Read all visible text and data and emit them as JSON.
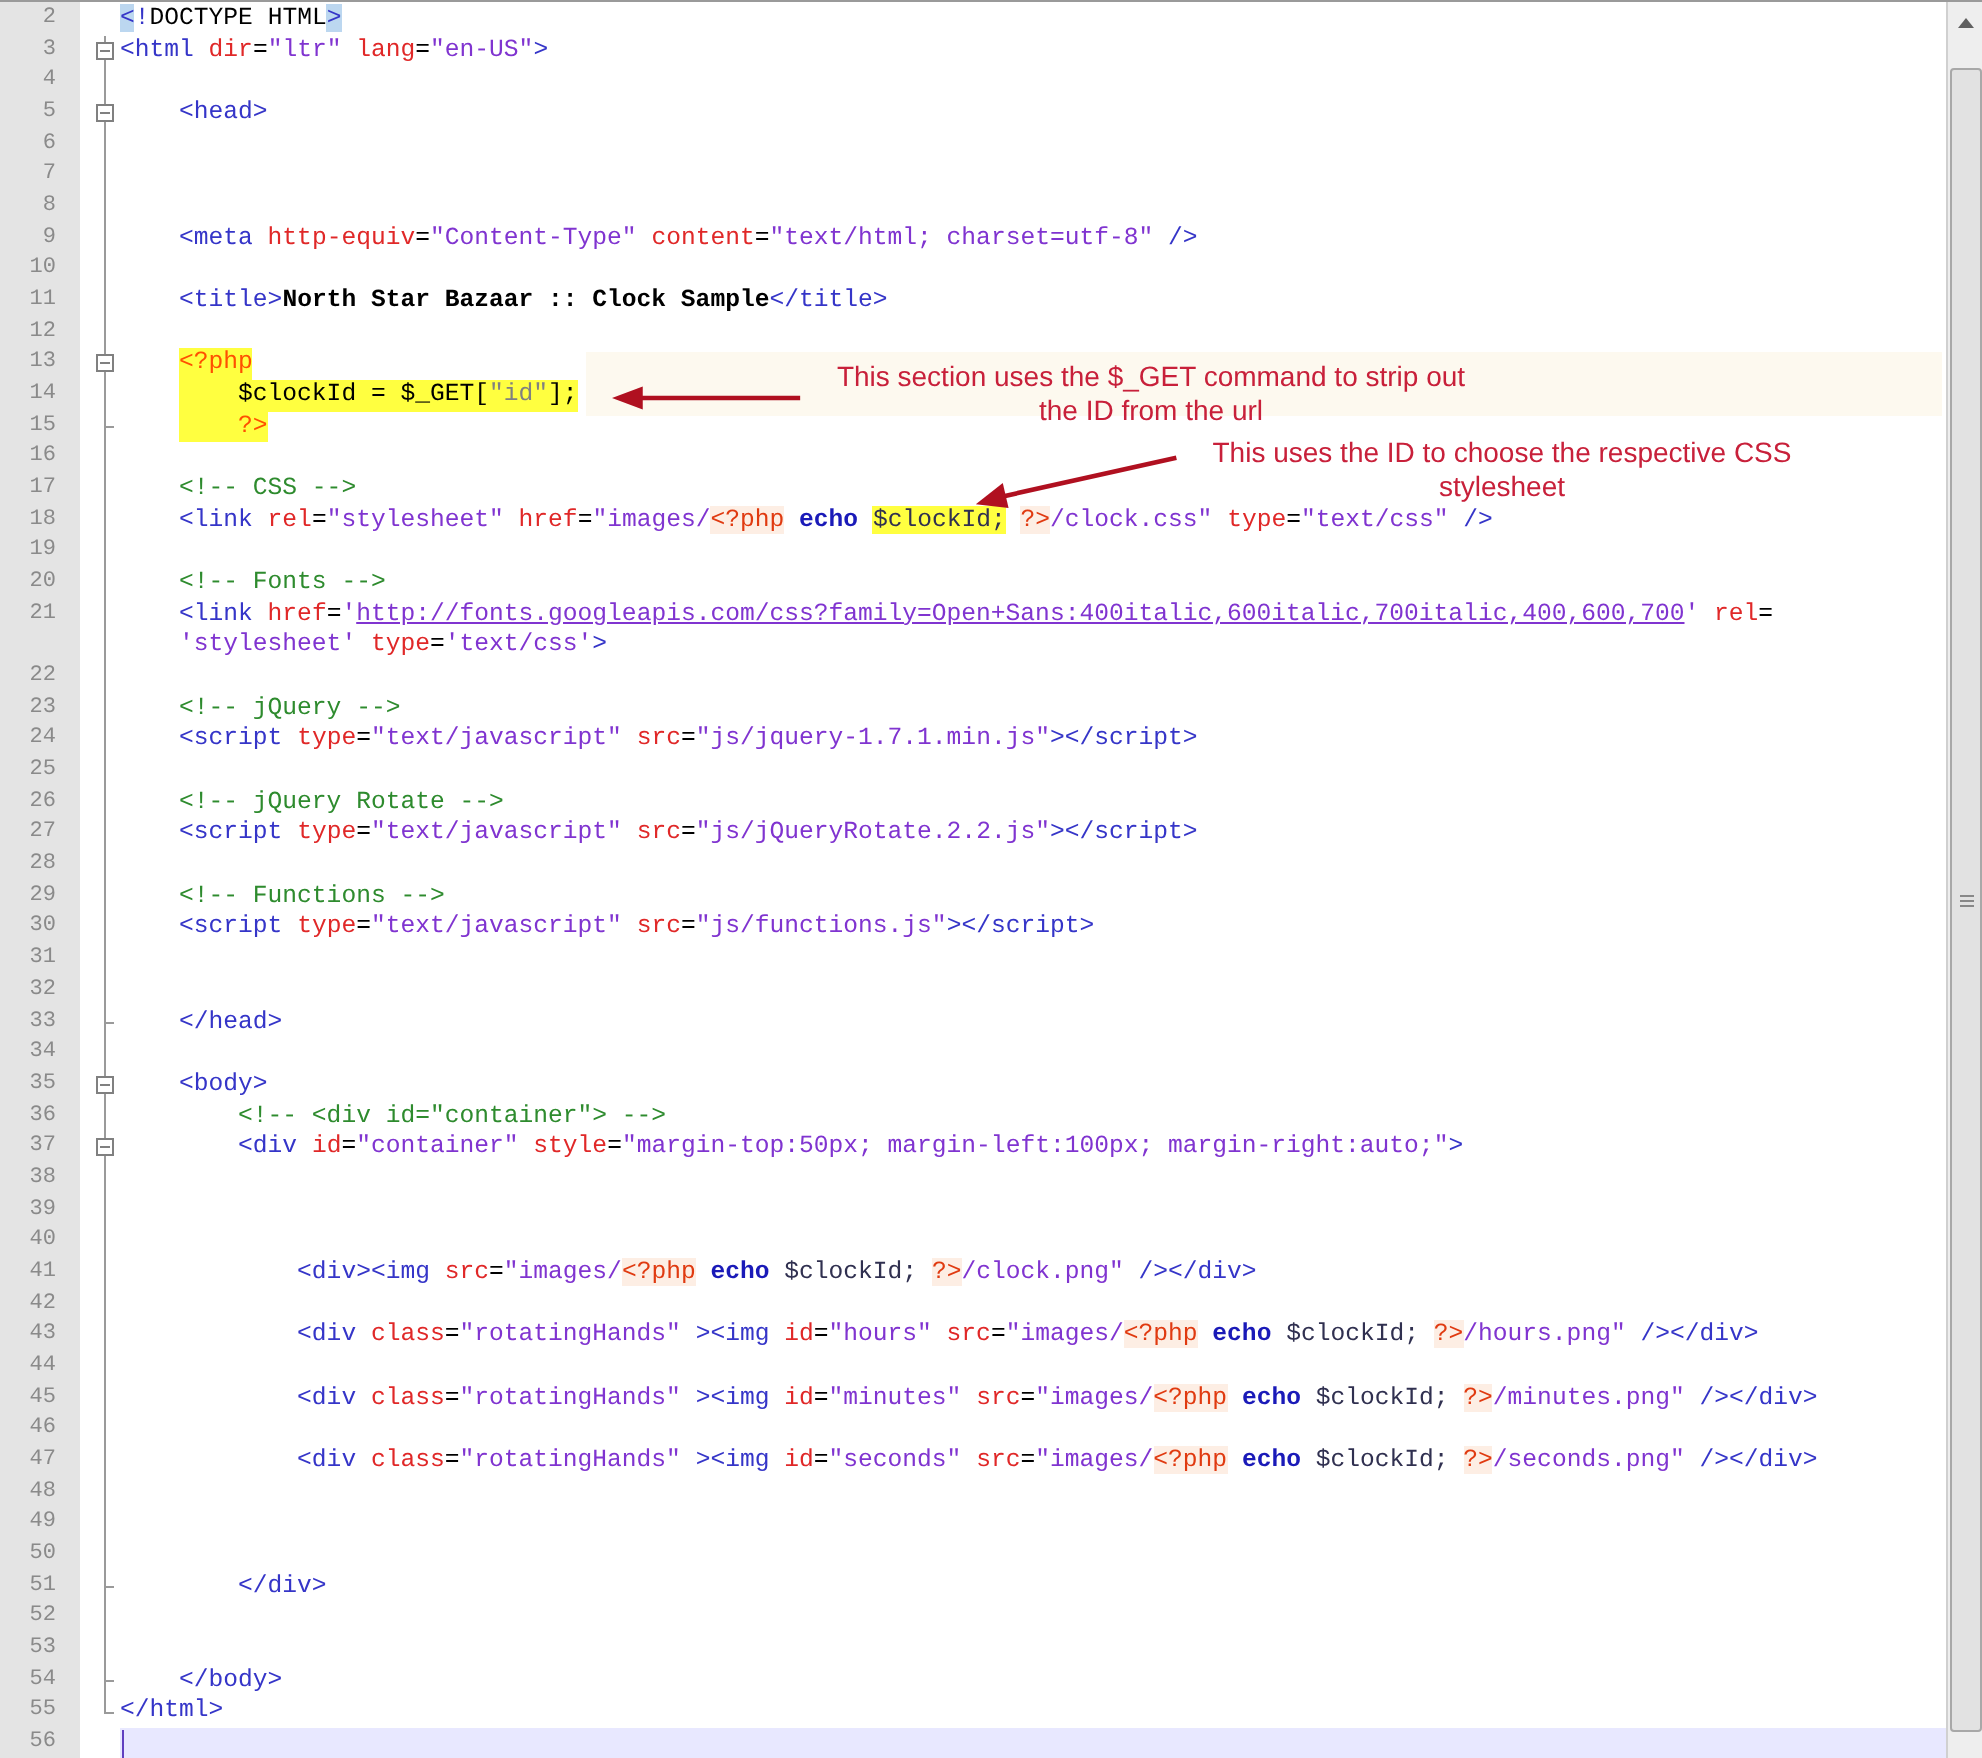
{
  "editor": {
    "lines": [
      {
        "number": "2",
        "tokens": [
          {
            "kind": "match",
            "text": "<"
          },
          {
            "kind": "tag",
            "text": "!"
          },
          {
            "kind": "plain",
            "text": "DOCTYPE HTML"
          },
          {
            "kind": "match",
            "text": ">"
          }
        ]
      },
      {
        "number": "3",
        "fold_start": true,
        "tokens": [
          {
            "kind": "tag",
            "text": "<html"
          },
          {
            "kind": "attr",
            "text": " dir"
          },
          {
            "kind": "plain",
            "text": "="
          },
          {
            "kind": "string",
            "text": "\"ltr\""
          },
          {
            "kind": "attr",
            "text": " lang"
          },
          {
            "kind": "plain",
            "text": "="
          },
          {
            "kind": "string",
            "text": "\"en-US\""
          },
          {
            "kind": "tag",
            "text": ">"
          }
        ]
      },
      {
        "number": "4"
      },
      {
        "number": "5",
        "fold_start": true,
        "tokens": [
          {
            "kind": "tag",
            "text": "    <head>"
          }
        ]
      },
      {
        "number": "6"
      },
      {
        "number": "7"
      },
      {
        "number": "8"
      },
      {
        "number": "9",
        "tokens": [
          {
            "kind": "tag",
            "text": "    <meta"
          },
          {
            "kind": "attr",
            "text": " http-equiv"
          },
          {
            "kind": "plain",
            "text": "="
          },
          {
            "kind": "string",
            "text": "\"Content-Type\""
          },
          {
            "kind": "attr",
            "text": " content"
          },
          {
            "kind": "plain",
            "text": "="
          },
          {
            "kind": "string",
            "text": "\"text/html; charset=utf-8\""
          },
          {
            "kind": "tag",
            "text": " />"
          }
        ]
      },
      {
        "number": "10"
      },
      {
        "number": "11",
        "tokens": [
          {
            "kind": "tag",
            "text": "    <title>"
          },
          {
            "kind": "text",
            "text": "North Star Bazaar :: Clock Sample"
          },
          {
            "kind": "tag",
            "text": "</title>"
          }
        ]
      },
      {
        "number": "12"
      },
      {
        "number": "13",
        "fold_start": true,
        "php_block": true,
        "tokens": [
          {
            "kind": "php-delim",
            "text": "    <?php"
          }
        ]
      },
      {
        "number": "14",
        "php_block": true,
        "tokens": [
          {
            "kind": "php",
            "text": "        $clockId = $_GET["
          },
          {
            "kind": "php-string",
            "text": "\"id\""
          },
          {
            "kind": "php",
            "text": "];"
          }
        ]
      },
      {
        "number": "15",
        "fold_end": true,
        "php_block": true,
        "tokens": [
          {
            "kind": "php-delim",
            "text": "        ?>"
          }
        ]
      },
      {
        "number": "16"
      },
      {
        "number": "17",
        "tokens": [
          {
            "kind": "comment",
            "text": "    <!-- CSS -->"
          }
        ]
      },
      {
        "number": "18",
        "tokens": [
          {
            "kind": "tag",
            "text": "    <link"
          },
          {
            "kind": "attr",
            "text": " rel"
          },
          {
            "kind": "plain",
            "text": "="
          },
          {
            "kind": "string",
            "text": "\"stylesheet\""
          },
          {
            "kind": "attr",
            "text": " href"
          },
          {
            "kind": "plain",
            "text": "="
          },
          {
            "kind": "string",
            "text": "\"images/"
          },
          {
            "kind": "php-tag",
            "text": "<?php"
          },
          {
            "kind": "keyword",
            "text": " echo "
          },
          {
            "kind": "var-match",
            "text": "$clockId;"
          },
          {
            "kind": "php-tag",
            "text": "?>"
          },
          {
            "kind": "string",
            "text": "/clock.css\""
          },
          {
            "kind": "attr",
            "text": " type"
          },
          {
            "kind": "plain",
            "text": "="
          },
          {
            "kind": "string",
            "text": "\"text/css\""
          },
          {
            "kind": "tag",
            "text": " />"
          }
        ]
      },
      {
        "number": "19"
      },
      {
        "number": "20",
        "tokens": [
          {
            "kind": "comment",
            "text": "    <!-- Fonts -->"
          }
        ]
      },
      {
        "number": "21",
        "tokens": [
          {
            "kind": "tag",
            "text": "    <link"
          },
          {
            "kind": "attr",
            "text": " href"
          },
          {
            "kind": "plain",
            "text": "="
          },
          {
            "kind": "string",
            "text": "'"
          },
          {
            "kind": "url",
            "text": "http://fonts.googleapis.com/css?family=Open+Sans:400italic,600italic,700italic,400,600,700"
          },
          {
            "kind": "string",
            "text": "'"
          },
          {
            "kind": "attr",
            "text": " rel"
          },
          {
            "kind": "plain",
            "text": "="
          }
        ],
        "wrapped_tokens": [
          {
            "kind": "string",
            "text": "    'stylesheet'"
          },
          {
            "kind": "attr",
            "text": " type"
          },
          {
            "kind": "plain",
            "text": "="
          },
          {
            "kind": "string",
            "text": "'text/css'"
          },
          {
            "kind": "tag",
            "text": ">"
          }
        ]
      },
      {
        "number": "22"
      },
      {
        "number": "23",
        "tokens": [
          {
            "kind": "comment",
            "text": "    <!-- jQuery -->"
          }
        ]
      },
      {
        "number": "24",
        "tokens": [
          {
            "kind": "tag",
            "text": "    <script"
          },
          {
            "kind": "attr",
            "text": " type"
          },
          {
            "kind": "plain",
            "text": "="
          },
          {
            "kind": "string",
            "text": "\"text/javascript\""
          },
          {
            "kind": "attr",
            "text": " src"
          },
          {
            "kind": "plain",
            "text": "="
          },
          {
            "kind": "string",
            "text": "\"js/jquery-1.7.1.min.js\""
          },
          {
            "kind": "tag",
            "text": "></script>"
          }
        ]
      },
      {
        "number": "25"
      },
      {
        "number": "26",
        "tokens": [
          {
            "kind": "comment",
            "text": "    <!-- jQuery Rotate -->"
          }
        ]
      },
      {
        "number": "27",
        "tokens": [
          {
            "kind": "tag",
            "text": "    <script"
          },
          {
            "kind": "attr",
            "text": " type"
          },
          {
            "kind": "plain",
            "text": "="
          },
          {
            "kind": "string",
            "text": "\"text/javascript\""
          },
          {
            "kind": "attr",
            "text": " src"
          },
          {
            "kind": "plain",
            "text": "="
          },
          {
            "kind": "string",
            "text": "\"js/jQueryRotate.2.2.js\""
          },
          {
            "kind": "tag",
            "text": "></script>"
          }
        ]
      },
      {
        "number": "28"
      },
      {
        "number": "29",
        "tokens": [
          {
            "kind": "comment",
            "text": "    <!-- Functions -->"
          }
        ]
      },
      {
        "number": "30",
        "tokens": [
          {
            "kind": "tag",
            "text": "    <script"
          },
          {
            "kind": "attr",
            "text": " type"
          },
          {
            "kind": "plain",
            "text": "="
          },
          {
            "kind": "string",
            "text": "\"text/javascript\""
          },
          {
            "kind": "attr",
            "text": " src"
          },
          {
            "kind": "plain",
            "text": "="
          },
          {
            "kind": "string",
            "text": "\"js/functions.js\""
          },
          {
            "kind": "tag",
            "text": "></script>"
          }
        ]
      },
      {
        "number": "31"
      },
      {
        "number": "32"
      },
      {
        "number": "33",
        "fold_end": true,
        "tokens": [
          {
            "kind": "tag",
            "text": "    </head>"
          }
        ]
      },
      {
        "number": "34"
      },
      {
        "number": "35",
        "fold_start": true,
        "tokens": [
          {
            "kind": "tag",
            "text": "    <body>"
          }
        ]
      },
      {
        "number": "36",
        "tokens": [
          {
            "kind": "comment",
            "text": "        <!-- <div id=\"container\"> -->"
          }
        ]
      },
      {
        "number": "37",
        "fold_start": true,
        "tokens": [
          {
            "kind": "tag",
            "text": "        <div"
          },
          {
            "kind": "attr",
            "text": " id"
          },
          {
            "kind": "plain",
            "text": "="
          },
          {
            "kind": "string",
            "text": "\"container\""
          },
          {
            "kind": "attr",
            "text": " style"
          },
          {
            "kind": "plain",
            "text": "="
          },
          {
            "kind": "string",
            "text": "\"margin-top:50px; margin-left:100px; margin-right:auto;\""
          },
          {
            "kind": "tag",
            "text": ">"
          }
        ]
      },
      {
        "number": "38"
      },
      {
        "number": "39"
      },
      {
        "number": "40"
      },
      {
        "number": "41",
        "tokens": [
          {
            "kind": "tag",
            "text": "            <div><img"
          },
          {
            "kind": "attr",
            "text": " src"
          },
          {
            "kind": "plain",
            "text": "="
          },
          {
            "kind": "string",
            "text": "\"images/"
          },
          {
            "kind": "php-tag",
            "text": "<?php"
          },
          {
            "kind": "keyword",
            "text": " echo"
          },
          {
            "kind": "var",
            "text": " $clockId; "
          },
          {
            "kind": "php-tag",
            "text": "?>"
          },
          {
            "kind": "string",
            "text": "/clock.png\""
          },
          {
            "kind": "tag",
            "text": " /></div>"
          }
        ]
      },
      {
        "number": "42"
      },
      {
        "number": "43",
        "tokens": [
          {
            "kind": "tag",
            "text": "            <div"
          },
          {
            "kind": "attr",
            "text": " class"
          },
          {
            "kind": "plain",
            "text": "="
          },
          {
            "kind": "string",
            "text": "\"rotatingHands\""
          },
          {
            "kind": "tag",
            "text": " ><img"
          },
          {
            "kind": "attr",
            "text": " id"
          },
          {
            "kind": "plain",
            "text": "="
          },
          {
            "kind": "string",
            "text": "\"hours\""
          },
          {
            "kind": "attr",
            "text": " src"
          },
          {
            "kind": "plain",
            "text": "="
          },
          {
            "kind": "string",
            "text": "\"images/"
          },
          {
            "kind": "php-tag",
            "text": "<?php"
          },
          {
            "kind": "keyword",
            "text": " echo"
          },
          {
            "kind": "var",
            "text": " $clockId; "
          },
          {
            "kind": "php-tag",
            "text": "?>"
          },
          {
            "kind": "string",
            "text": "/hours.png\""
          },
          {
            "kind": "tag",
            "text": " /></div>"
          }
        ]
      },
      {
        "number": "44"
      },
      {
        "number": "45",
        "tokens": [
          {
            "kind": "tag",
            "text": "            <div"
          },
          {
            "kind": "attr",
            "text": " class"
          },
          {
            "kind": "plain",
            "text": "="
          },
          {
            "kind": "string",
            "text": "\"rotatingHands\""
          },
          {
            "kind": "tag",
            "text": " ><img"
          },
          {
            "kind": "attr",
            "text": " id"
          },
          {
            "kind": "plain",
            "text": "="
          },
          {
            "kind": "string",
            "text": "\"minutes\""
          },
          {
            "kind": "attr",
            "text": " src"
          },
          {
            "kind": "plain",
            "text": "="
          },
          {
            "kind": "string",
            "text": "\"images/"
          },
          {
            "kind": "php-tag",
            "text": "<?php"
          },
          {
            "kind": "keyword",
            "text": " echo"
          },
          {
            "kind": "var",
            "text": " $clockId; "
          },
          {
            "kind": "php-tag",
            "text": "?>"
          },
          {
            "kind": "string",
            "text": "/minutes.png\""
          },
          {
            "kind": "tag",
            "text": " /></div>"
          }
        ]
      },
      {
        "number": "46"
      },
      {
        "number": "47",
        "tokens": [
          {
            "kind": "tag",
            "text": "            <div"
          },
          {
            "kind": "attr",
            "text": " class"
          },
          {
            "kind": "plain",
            "text": "="
          },
          {
            "kind": "string",
            "text": "\"rotatingHands\""
          },
          {
            "kind": "tag",
            "text": " ><img"
          },
          {
            "kind": "attr",
            "text": " id"
          },
          {
            "kind": "plain",
            "text": "="
          },
          {
            "kind": "string",
            "text": "\"seconds\""
          },
          {
            "kind": "attr",
            "text": " src"
          },
          {
            "kind": "plain",
            "text": "="
          },
          {
            "kind": "string",
            "text": "\"images/"
          },
          {
            "kind": "php-tag",
            "text": "<?php"
          },
          {
            "kind": "keyword",
            "text": " echo"
          },
          {
            "kind": "var",
            "text": " $clockId; "
          },
          {
            "kind": "php-tag",
            "text": "?>"
          },
          {
            "kind": "string",
            "text": "/seconds.png\""
          },
          {
            "kind": "tag",
            "text": " /></div>"
          }
        ]
      },
      {
        "number": "48"
      },
      {
        "number": "49"
      },
      {
        "number": "50"
      },
      {
        "number": "51",
        "fold_end": true,
        "tokens": [
          {
            "kind": "tag",
            "text": "        </div>"
          }
        ]
      },
      {
        "number": "52"
      },
      {
        "number": "53"
      },
      {
        "number": "54",
        "fold_end": true,
        "tokens": [
          {
            "kind": "tag",
            "text": "    </body>"
          }
        ]
      },
      {
        "number": "55",
        "fold_end": true,
        "tokens": [
          {
            "kind": "tag",
            "text": "</html>"
          }
        ]
      },
      {
        "number": "56",
        "current": true
      }
    ]
  },
  "annotations": [
    {
      "text": "This section uses the $_GET command to strip out the ID from the url"
    },
    {
      "text": "This uses the ID to choose the respective CSS stylesheet"
    }
  ]
}
